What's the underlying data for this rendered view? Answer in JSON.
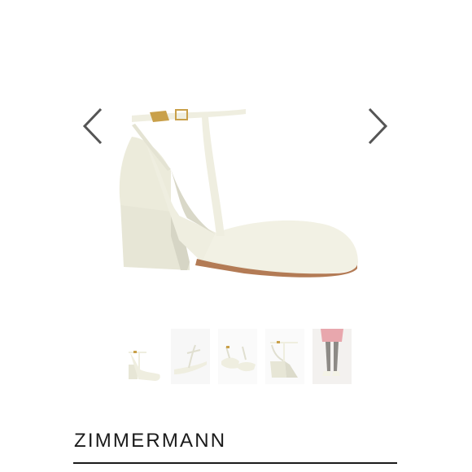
{
  "product": {
    "brand": "ZIMMERMANN",
    "image_description_icon": "shoe-image"
  },
  "gallery": {
    "prev_icon": "chevron-left-icon",
    "next_icon": "chevron-right-icon",
    "thumbnail_count": 5
  },
  "colors": {
    "shoe": "#eeeee0",
    "shoe_shadow": "#d9d8c8",
    "sole": "#b37b55",
    "buckle": "#c9a04a",
    "arrow": "#555555",
    "text": "#1a1a1a"
  }
}
